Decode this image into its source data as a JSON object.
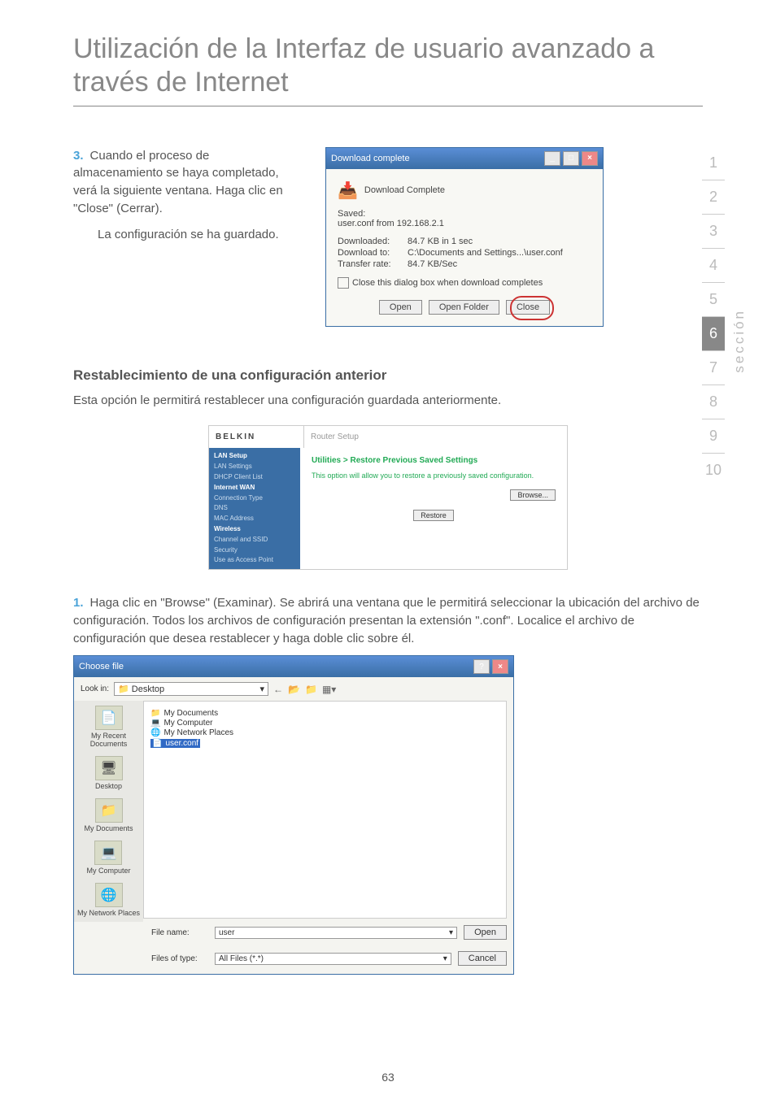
{
  "title": "Utilización de la Interfaz de usuario avanzado a través de Internet",
  "step3": {
    "num": "3.",
    "text": "Cuando el proceso de almacenamiento se haya completado, verá la siguiente ventana. Haga clic en \"Close\" (Cerrar).",
    "sub": "La configuración se ha guardado."
  },
  "dl": {
    "title": "Download complete",
    "heading": "Download Complete",
    "saved": "Saved:",
    "saved_val": "user.conf from 192.168.2.1",
    "r1_lab": "Downloaded:",
    "r1_val": "84.7 KB in 1 sec",
    "r2_lab": "Download to:",
    "r2_val": "C:\\Documents and Settings...\\user.conf",
    "r3_lab": "Transfer rate:",
    "r3_val": "84.7 KB/Sec",
    "chk": "Close this dialog box when download completes",
    "btn_open": "Open",
    "btn_folder": "Open Folder",
    "btn_close": "Close"
  },
  "sec2": {
    "heading": "Restablecimiento de una configuración anterior",
    "text": "Esta opción le permitirá restablecer una configuración guardada anteriormente."
  },
  "belkin": {
    "logo": "BELKIN",
    "rs": "Router Setup",
    "nav": {
      "h1": "LAN Setup",
      "i1": "LAN Settings",
      "i2": "DHCP Client List",
      "h2": "Internet WAN",
      "i3": "Connection Type",
      "i4": "DNS",
      "i5": "MAC Address",
      "h3": "Wireless",
      "i6": "Channel and SSID",
      "i7": "Security",
      "i8": "Use as Access Point"
    },
    "main_title": "Utilities > Restore Previous Saved Settings",
    "main_desc": "This option will allow you to restore a previously saved configuration.",
    "browse": "Browse...",
    "restore": "Restore"
  },
  "step1": {
    "num": "1.",
    "text": "Haga clic en \"Browse\" (Examinar). Se abrirá una ventana que le permitirá seleccionar la ubicación del archivo de configuración. Todos los archivos de configuración presentan la extensión \".conf\". Localice el archivo de configuración que desea restablecer y haga doble clic sobre él."
  },
  "choose": {
    "title": "Choose file",
    "lookin": "Look in:",
    "lookin_val": "Desktop",
    "side": {
      "s1": "My Recent Documents",
      "s2": "Desktop",
      "s3": "My Documents",
      "s4": "My Computer",
      "s5": "My Network Places"
    },
    "files": {
      "f1": "My Documents",
      "f2": "My Computer",
      "f3": "My Network Places",
      "f4": "user.conf"
    },
    "fn_lab": "File name:",
    "fn_val": "user",
    "ft_lab": "Files of type:",
    "ft_val": "All Files (*.*)",
    "btn_open": "Open",
    "btn_cancel": "Cancel"
  },
  "nav": {
    "n1": "1",
    "n2": "2",
    "n3": "3",
    "n4": "4",
    "n5": "5",
    "n6": "6",
    "n7": "7",
    "n8": "8",
    "n9": "9",
    "n10": "10",
    "label": "sección"
  },
  "pagenum": "63"
}
